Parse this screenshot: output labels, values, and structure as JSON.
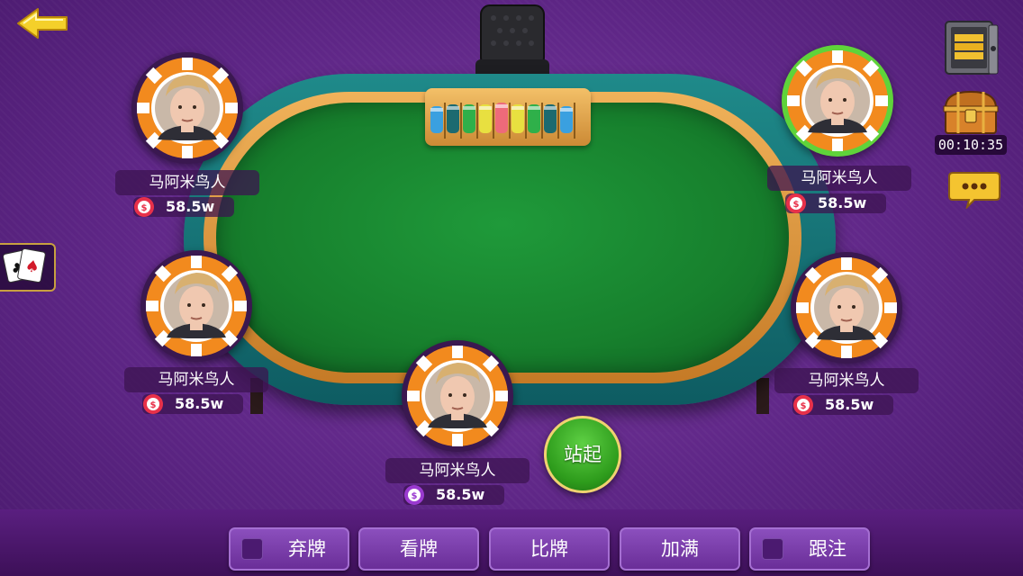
{
  "colors": {
    "background": "#5e2686",
    "felt": "#17802d",
    "rail": "#0e5c62",
    "wood": "#d48a30",
    "chip_orange": "#f28a1e",
    "active_ring": "#5fd33a",
    "stand_button": "#2e9c1c"
  },
  "icons": {
    "back": "back-arrow-icon",
    "safe": "safe-icon",
    "chest": "treasure-chest-icon",
    "chat": "chat-bubble-icon",
    "cards": "playing-cards-icon",
    "money": "coin-icon"
  },
  "timer": "00:10:35",
  "stand_button": "站起",
  "players": [
    {
      "name": "马阿米鸟人",
      "money": "58.5w",
      "active": false
    },
    {
      "name": "马阿米鸟人",
      "money": "58.5w",
      "active": true
    },
    {
      "name": "马阿米鸟人",
      "money": "58.5w",
      "active": false
    },
    {
      "name": "马阿米鸟人",
      "money": "58.5w",
      "active": false
    },
    {
      "name": "马阿米鸟人",
      "money": "58.5w",
      "active": false
    }
  ],
  "actions": [
    {
      "label": "弃牌",
      "checkbox": true
    },
    {
      "label": "看牌",
      "checkbox": false
    },
    {
      "label": "比牌",
      "checkbox": false
    },
    {
      "label": "加满",
      "checkbox": false
    },
    {
      "label": "跟注",
      "checkbox": true
    }
  ]
}
